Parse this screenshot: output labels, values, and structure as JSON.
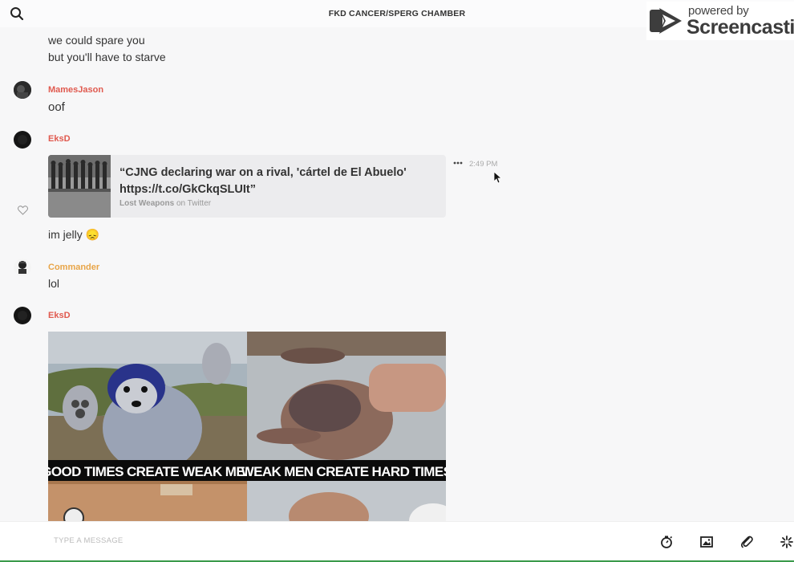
{
  "header": {
    "title": "FKD CANCER/SPERG CHAMBER",
    "search_icon": "search-icon",
    "phone_icon": "phone-icon",
    "info_icon": "info-icon"
  },
  "watermark": {
    "powered_by": "powered by",
    "brand": "Screencastify"
  },
  "messages": {
    "prev_lines": [
      "we could spare you",
      "but you'll have to starve"
    ],
    "mamesjason": {
      "name": "MamesJason",
      "text": "oof"
    },
    "eksd1": {
      "name": "EksD",
      "card_title": "“CJNG declaring war on a rival, 'cártel de El Abuelo' https://t.co/GkCkqSLUIt”",
      "card_source_name": "Lost Weapons",
      "card_source_suffix": "on Twitter",
      "timestamp": "2:49 PM",
      "follow_up": "im jelly 😞"
    },
    "commander": {
      "name": "Commander",
      "text": "lol"
    },
    "eksd2": {
      "name": "EksD",
      "caption_left": "GOOD TIMES CREATE WEAK MEN",
      "caption_right": "WEAK MEN CREATE HARD TIMES"
    }
  },
  "composer": {
    "placeholder": "TYPE A MESSAGE",
    "tools": [
      "timer-icon",
      "image-icon",
      "paperclip-icon",
      "giphy-icon"
    ]
  },
  "colors": {
    "name_red": "#e05a4f",
    "name_orange": "#e8a548",
    "status_bar": "#3a9a4b"
  }
}
